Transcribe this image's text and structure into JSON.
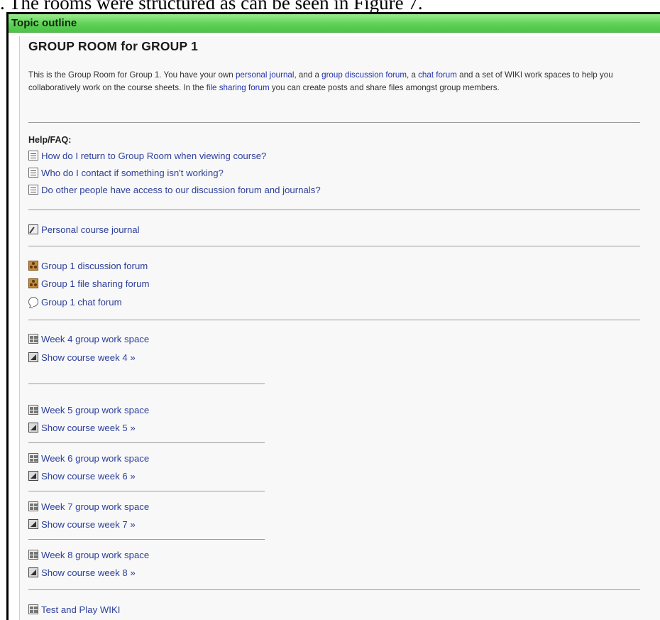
{
  "caption": ". The rooms were structured as can be seen in Figure 7.",
  "header": {
    "title": "Topic outline"
  },
  "room": {
    "title": "GROUP ROOM for GROUP 1",
    "intro": {
      "t1": "This is the Group Room for Group 1. You have your own ",
      "l1": "personal journal",
      "t2": ", and a ",
      "l2": "group discussion forum",
      "t3": ", a ",
      "l3": "chat forum",
      "t4": " and a set of WIKI work spaces to help you collaboratively work on the course sheets. In the ",
      "l4": "file sharing forum",
      "t5": " you can create posts and share files amongst group members."
    }
  },
  "help": {
    "heading": "Help/FAQ:",
    "items": [
      "How do I return to Group Room when viewing course?",
      "Who do I contact if something isn't working?",
      "Do other people have access to our discussion forum and journals?"
    ]
  },
  "journal": "Personal course journal",
  "forums": [
    "Group 1 discussion forum",
    "Group 1 file sharing forum",
    "Group 1 chat forum"
  ],
  "weeks": [
    {
      "space": "Week 4 group work space",
      "show": "Show course week 4 »"
    },
    {
      "space": "Week 5 group work space",
      "show": "Show course week 5 »"
    },
    {
      "space": "Week 6 group work space",
      "show": "Show course week 6 »"
    },
    {
      "space": "Week 7 group work space",
      "show": "Show course week 7 »"
    },
    {
      "space": "Week 8 group work space",
      "show": "Show course week 8 »"
    }
  ],
  "test_wiki": "Test and Play WIKI",
  "colors": {
    "header_green": "#5fd156",
    "link": "#2d3f9a"
  },
  "icons": {
    "faq": "page-icon",
    "journal": "journal-icon",
    "forum": "forum-icon",
    "chat": "chat-icon",
    "wiki": "wiki-icon",
    "week": "course-week-icon"
  }
}
